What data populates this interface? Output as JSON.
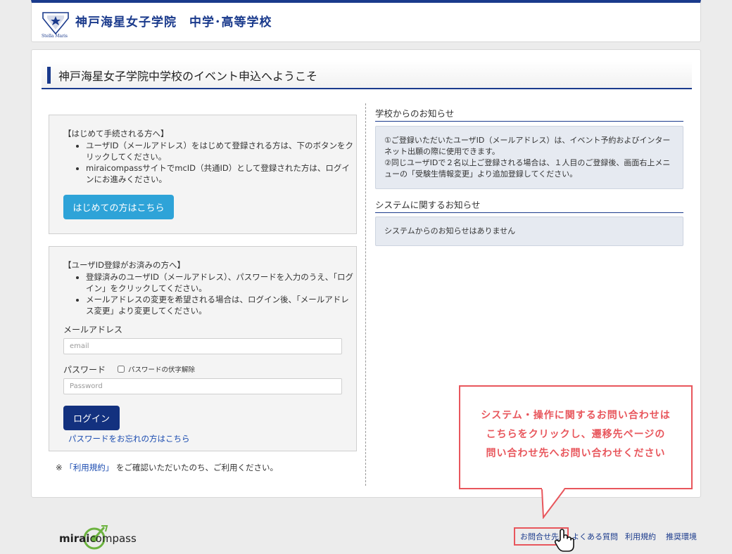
{
  "header": {
    "school_name": "神戸海星女子学院　中学･高等学校",
    "logo_caption": "Stella Maris"
  },
  "page": {
    "title": "神戸海星女子学院中学校のイベント申込へようこそ"
  },
  "first_time": {
    "heading": "【はじめて手続される方へ】",
    "bullets": [
      "ユーザID（メールアドレス）をはじめて登録される方は、下のボタンをクリックしてください。",
      "miraicompassサイトでmcID（共通ID）として登録された方は、ログインにお進みください。"
    ],
    "button_label": "はじめての方はこちら"
  },
  "registered": {
    "heading": "【ユーザID登録がお済みの方へ】",
    "bullets": [
      "登録済みのユーザID（メールアドレス）、パスワードを入力のうえ、「ログイン」をクリックしてください。",
      "メールアドレスの変更を希望される場合は、ログイン後、「メールアドレス変更」より変更してください。"
    ],
    "email_label": "メールアドレス",
    "email_placeholder": "email",
    "email_value": "",
    "password_label": "パスワード",
    "show_password_label": "パスワードの伏字解除",
    "password_placeholder": "Password",
    "login_button": "ログイン",
    "forgot_link": "パスワードをお忘れの方はこちら"
  },
  "terms_note": {
    "prefix": "※",
    "link": "「利用規約」",
    "suffix": "をご確認いただいたのち、ご利用ください。"
  },
  "school_notice": {
    "heading": "学校からのお知らせ",
    "lines": [
      "①ご登録いただいたユーザID（メールアドレス）は、イベント予約およびインターネット出願の際に使用できます。",
      "②同じユーザIDで２名以上ご登録される場合は、１人目のご登録後、画面右上メニューの「受験生情報変更」より追加登録してください。"
    ]
  },
  "system_notice": {
    "heading": "システムに関するお知らせ",
    "text": "システムからのお知らせはありません"
  },
  "callout": {
    "lines": [
      "システム・操作に関するお問い合わせは",
      "こちらをクリックし、遷移先ページの",
      "問い合わせ先へお問い合わせください"
    ]
  },
  "footer": {
    "brand_bold": "mirai",
    "brand_light": "compass",
    "links": [
      "お問合せ先",
      "よくある質問",
      "利用規約",
      "推奨環境"
    ]
  },
  "colors": {
    "navy": "#1a3a8c",
    "first_button": "#2ea3d8",
    "login_button": "#13317f",
    "callout_red": "#e8565c",
    "notice_bg": "#e6eaf1"
  }
}
